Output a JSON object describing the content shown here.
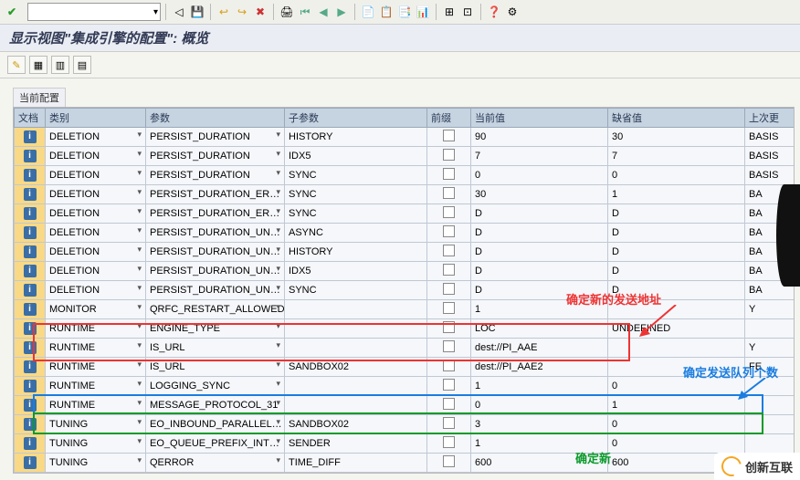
{
  "title": "显示视图\"集成引擎的配置\": 概览",
  "section": "当前配置",
  "toolbar_combo_icon": "▾",
  "columns": {
    "doc": "文档",
    "cat": "类别",
    "param": "参数",
    "sub": "子参数",
    "prefix": "前缀",
    "cur": "当前值",
    "def": "缺省值",
    "last": "上次更"
  },
  "rows": [
    {
      "cat": "DELETION",
      "param": "PERSIST_DURATION",
      "sub": "HISTORY",
      "cur": "90",
      "def": "30",
      "last": "BASIS"
    },
    {
      "cat": "DELETION",
      "param": "PERSIST_DURATION",
      "sub": "IDX5",
      "cur": "7",
      "def": "7",
      "last": "BASIS"
    },
    {
      "cat": "DELETION",
      "param": "PERSIST_DURATION",
      "sub": "SYNC",
      "cur": "0",
      "def": "0",
      "last": "BASIS"
    },
    {
      "cat": "DELETION",
      "param": "PERSIST_DURATION_ER…",
      "sub": "SYNC",
      "cur": "30",
      "def": "1",
      "last": "BA"
    },
    {
      "cat": "DELETION",
      "param": "PERSIST_DURATION_ER…",
      "sub": "SYNC",
      "cur": "D",
      "def": "D",
      "last": "BA"
    },
    {
      "cat": "DELETION",
      "param": "PERSIST_DURATION_UN…",
      "sub": "ASYNC",
      "cur": "D",
      "def": "D",
      "last": "BA"
    },
    {
      "cat": "DELETION",
      "param": "PERSIST_DURATION_UN…",
      "sub": "HISTORY",
      "cur": "D",
      "def": "D",
      "last": "BA"
    },
    {
      "cat": "DELETION",
      "param": "PERSIST_DURATION_UN…",
      "sub": "IDX5",
      "cur": "D",
      "def": "D",
      "last": "BA"
    },
    {
      "cat": "DELETION",
      "param": "PERSIST_DURATION_UN…",
      "sub": "SYNC",
      "cur": "D",
      "def": "D",
      "last": "BA"
    },
    {
      "cat": "MONITOR",
      "param": "QRFC_RESTART_ALLOWED",
      "sub": "",
      "cur": "1",
      "def": "",
      "last": "Y"
    },
    {
      "cat": "RUNTIME",
      "param": "ENGINE_TYPE",
      "sub": "",
      "cur": "LOC",
      "def": "UNDEFINED",
      "last": ""
    },
    {
      "cat": "RUNTIME",
      "param": "IS_URL",
      "sub": "",
      "cur": "dest://PI_AAE",
      "def": "",
      "last": "Y"
    },
    {
      "cat": "RUNTIME",
      "param": "IS_URL",
      "sub": "SANDBOX02",
      "cur": "dest://PI_AAE2",
      "def": "",
      "last": "FE"
    },
    {
      "cat": "RUNTIME",
      "param": "LOGGING_SYNC",
      "sub": "",
      "cur": "1",
      "def": "0",
      "last": ""
    },
    {
      "cat": "RUNTIME",
      "param": "MESSAGE_PROTOCOL_31",
      "sub": "",
      "cur": "0",
      "def": "1",
      "last": ""
    },
    {
      "cat": "TUNING",
      "param": "EO_INBOUND_PARALLEL…",
      "sub": "SANDBOX02",
      "cur": "3",
      "def": "0",
      "last": ""
    },
    {
      "cat": "TUNING",
      "param": "EO_QUEUE_PREFIX_INT…",
      "sub": "SENDER",
      "cur": "1",
      "def": "0",
      "last": ""
    },
    {
      "cat": "TUNING",
      "param": "QERROR",
      "sub": "TIME_DIFF",
      "cur": "600",
      "def": "600",
      "last": ""
    }
  ],
  "annotations": {
    "new_addr": "确定新的发送地址",
    "queue_cnt": "确定发送队列个数",
    "new_green": "确定新"
  },
  "logo_text": "创新互联"
}
